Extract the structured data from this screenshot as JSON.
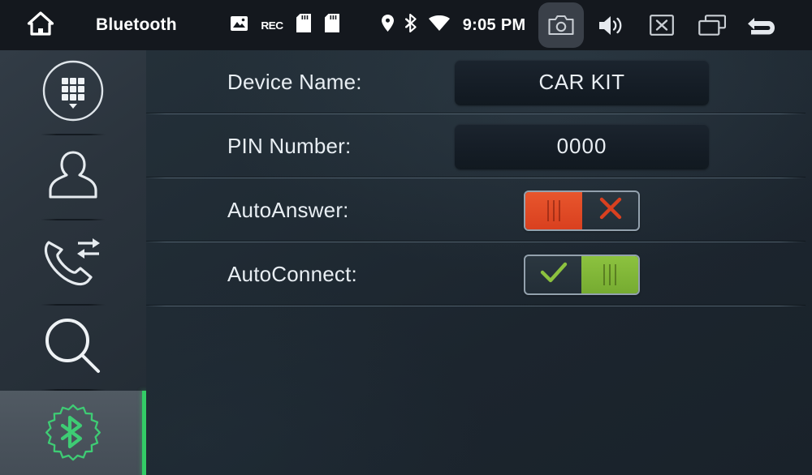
{
  "statusbar": {
    "home_icon": "home-icon",
    "title": "Bluetooth",
    "left_icons": [
      {
        "name": "gallery-icon",
        "label": ""
      },
      {
        "name": "rec-icon",
        "label": "REC"
      },
      {
        "name": "sd-card-1-icon",
        "label": ""
      },
      {
        "name": "sd-card-2-icon",
        "label": ""
      }
    ],
    "mid_icons": [
      {
        "name": "location-icon"
      },
      {
        "name": "bluetooth-icon"
      },
      {
        "name": "wifi-icon"
      }
    ],
    "time": "9:05 PM",
    "right_buttons": [
      {
        "name": "camera-button",
        "active": true
      },
      {
        "name": "volume-button",
        "active": false
      },
      {
        "name": "close-button",
        "active": false
      },
      {
        "name": "windows-button",
        "active": false
      },
      {
        "name": "back-button",
        "active": false
      }
    ]
  },
  "sidebar": {
    "items": [
      {
        "name": "sidebar-item-dialpad",
        "icon": "dialpad-icon",
        "selected": false
      },
      {
        "name": "sidebar-item-contacts",
        "icon": "contact-icon",
        "selected": false
      },
      {
        "name": "sidebar-item-call-history",
        "icon": "call-history-icon",
        "selected": false
      },
      {
        "name": "sidebar-item-search",
        "icon": "search-icon",
        "selected": false
      },
      {
        "name": "sidebar-item-bluetooth-settings",
        "icon": "bluetooth-gear-icon",
        "selected": true
      }
    ],
    "active_accent": "#33cc66"
  },
  "main": {
    "rows": [
      {
        "label": "Device Name:",
        "type": "field",
        "value": "CAR KIT"
      },
      {
        "label": "PIN Number:",
        "type": "field",
        "value": "0000"
      },
      {
        "label": "AutoAnswer:",
        "type": "toggle",
        "state": "off",
        "off_icon": "cross-icon",
        "on_icon": "check-icon"
      },
      {
        "label": "AutoConnect:",
        "type": "toggle",
        "state": "on",
        "off_icon": "cross-icon",
        "on_icon": "check-icon"
      }
    ]
  },
  "colors": {
    "toggle_off": "#d9401f",
    "toggle_on": "#8cc23f",
    "accent_green": "#33cc66",
    "panel_bg": "#1c252e",
    "statusbar_bg": "#14181e",
    "field_bg": "#151d26"
  }
}
